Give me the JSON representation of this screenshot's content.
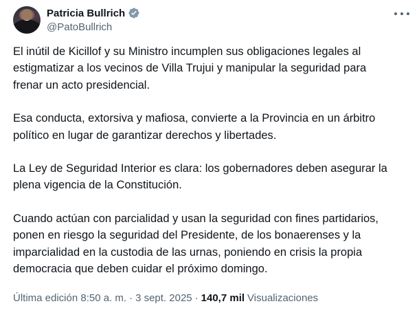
{
  "author": {
    "display_name": "Patricia Bullrich",
    "handle": "@PatoBullrich",
    "verified_color": "#829aab"
  },
  "menu": {
    "icon": "more-horizontal-icon"
  },
  "tweet": {
    "paragraphs": [
      "El inútil de Kicillof y su Ministro incumplen sus obligaciones legales al\nestigmatizar a los vecinos de Villa Trujui y manipular la seguridad para\nfrenar un acto presidencial.",
      "Esa conducta, extorsiva y mafiosa, convierte a la Provincia en un árbitro\npolítico en lugar de garantizar derechos y libertades.",
      "La Ley de Seguridad Interior es clara: los gobernadores deben asegurar la\nplena vigencia de la Constitución.",
      "Cuando actúan con parcialidad y usan la seguridad con fines partidarios,\nponen en riesgo la seguridad del Presidente, de los bonaerenses y la\nimparcialidad en la custodia de las urnas, poniendo en crisis la propia\ndemocracia que deben cuidar el próximo domingo."
    ]
  },
  "meta": {
    "edited_time": "Última edición 8:50 a. m.",
    "separator": "·",
    "date": "3 sept. 2025",
    "views_count": "140,7 mil",
    "views_label": "Visualizaciones"
  }
}
